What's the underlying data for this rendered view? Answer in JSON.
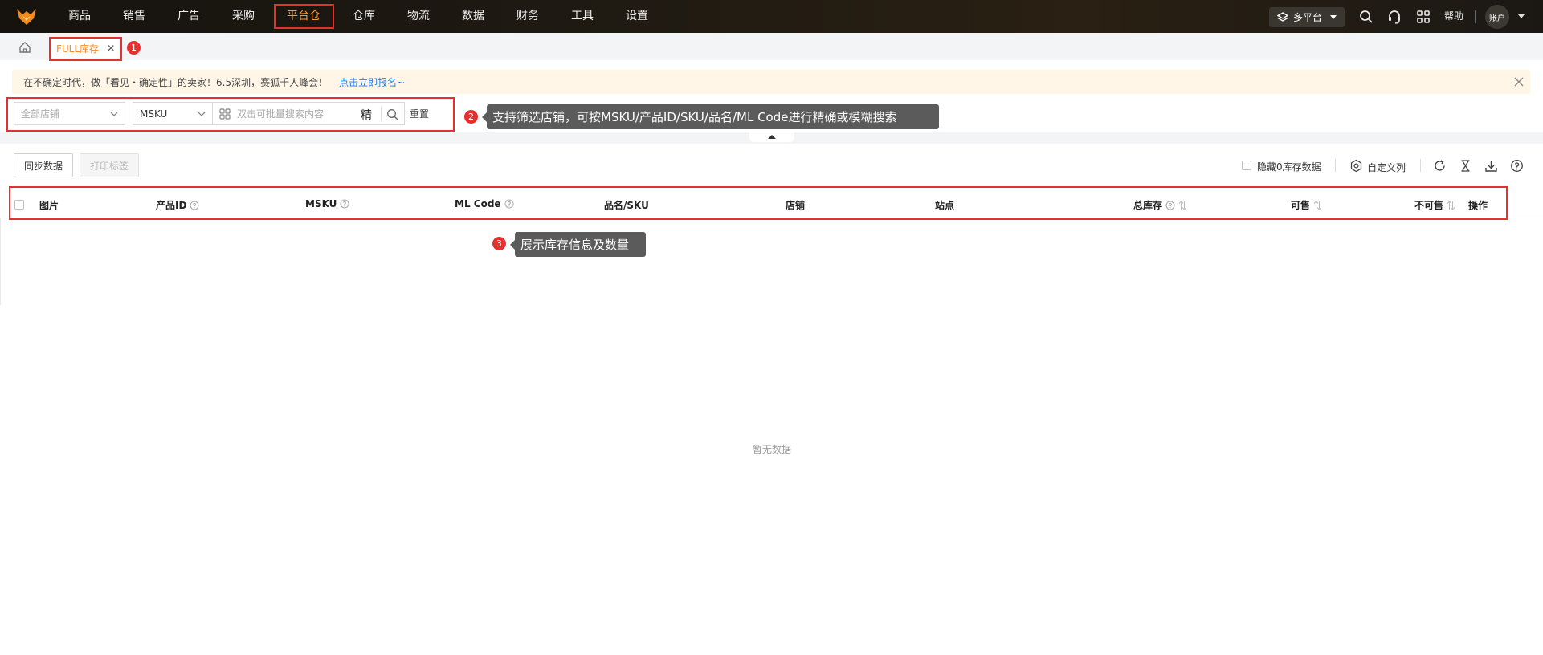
{
  "nav": {
    "items": [
      "商品",
      "销售",
      "广告",
      "采购",
      "平台仓",
      "仓库",
      "物流",
      "数据",
      "财务",
      "工具",
      "设置"
    ],
    "active": "平台仓",
    "platform_label": "多平台",
    "help": "帮助",
    "account": "账户"
  },
  "tabs": {
    "active_label": "FULL库存",
    "close": "✕"
  },
  "callouts": {
    "c1": "1",
    "c2": "2",
    "c3": "3",
    "tip2": "支持筛选店铺，可按MSKU/产品ID/SKU/品名/ML Code进行精确或模糊搜索",
    "tip3": "展示库存信息及数量"
  },
  "notice": {
    "text": "在不确定时代，做「看见・确定性」的卖家！6.5深圳，赛狐千人峰会！",
    "link": "点击立即报名~"
  },
  "filters": {
    "store_placeholder": "全部店铺",
    "search_field": "MSKU",
    "search_placeholder": "双击可批量搜索内容",
    "exact": "精",
    "reset": "重置"
  },
  "toolbar": {
    "sync": "同步数据",
    "print": "打印标签",
    "hide_zero": "隐藏0库存数据",
    "custom_columns": "自定义列"
  },
  "table": {
    "headers": {
      "image": "图片",
      "product_id": "产品ID",
      "msku": "MSKU",
      "ml_code": "ML Code",
      "name_sku": "品名/SKU",
      "store": "店铺",
      "site": "站点",
      "total_stock": "总库存",
      "available": "可售",
      "unavailable": "不可售",
      "actions": "操作"
    },
    "empty_text": "暂无数据"
  },
  "colors": {
    "accent": "#ff9a2e",
    "highlight": "#e5302f",
    "link": "#1a7ff0"
  }
}
